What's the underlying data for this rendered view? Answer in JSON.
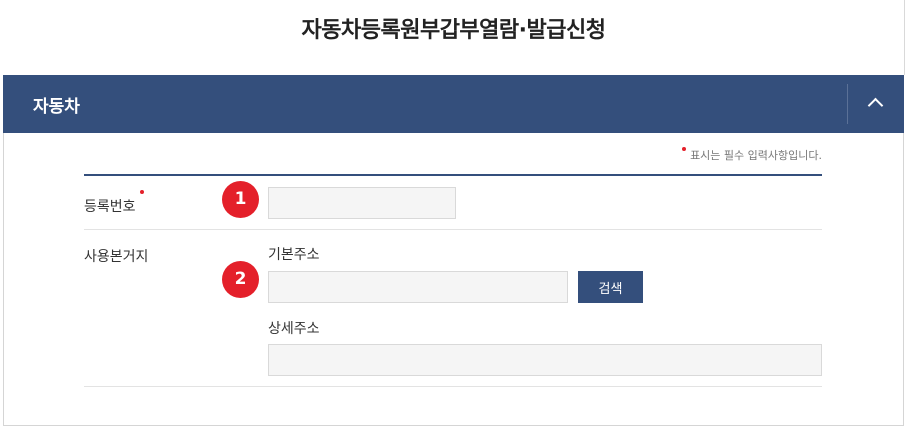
{
  "page": {
    "title": "자동차등록원부갑부열람·발급신청"
  },
  "panel": {
    "title": "자동차",
    "toggle_icon": "chevron-up-icon"
  },
  "form": {
    "required_note": "표시는 필수 입력사항입니다.",
    "registration": {
      "label": "등록번호",
      "required": true,
      "value": "",
      "marker": "1"
    },
    "base_location": {
      "label": "사용본거지",
      "basic_address_label": "기본주소",
      "basic_address_value": "",
      "search_button": "검색",
      "detail_address_label": "상세주소",
      "detail_address_value": "",
      "marker": "2"
    }
  },
  "colors": {
    "header_bg": "#344f7c",
    "required_dot": "#e4202a",
    "marker": "#e4202a"
  }
}
